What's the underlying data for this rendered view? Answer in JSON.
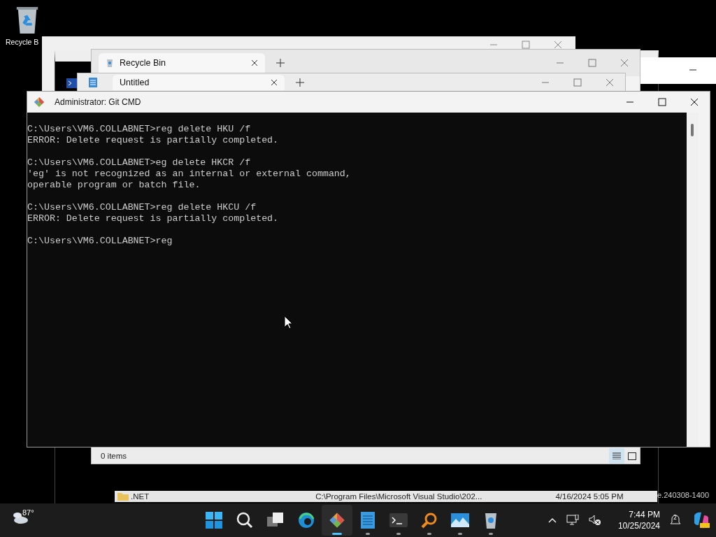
{
  "desktop_icons": [
    {
      "label": "Recycle B"
    }
  ],
  "windows": [
    {
      "kind": "blank"
    },
    {
      "kind": "console"
    },
    {
      "kind": "strip"
    },
    {
      "kind": "explorer",
      "tab": "Recycle Bin",
      "status": "0 items",
      "views": [
        {
          "selected": true
        },
        {
          "selected": false
        }
      ]
    },
    {
      "kind": "notepad",
      "tab": "Untitled"
    },
    {
      "kind": "filerow",
      "name": ".NET",
      "path": "C:\\Program Files\\Microsoft Visual Studio\\202...",
      "date": "4/16/2024 5:05 PM",
      "tail": "e.240308-1400"
    }
  ],
  "terminal": {
    "title": "Administrator: Git CMD",
    "blocks": [
      [
        "C:\\Users\\VM6.COLLABNET>reg delete HKU /f",
        "ERROR: Delete request is partially completed."
      ],
      [
        "C:\\Users\\VM6.COLLABNET>eg delete HKCR /f",
        "'eg' is not recognized as an internal or external command,",
        "operable program or batch file."
      ],
      [
        "C:\\Users\\VM6.COLLABNET>reg delete HKCU /f",
        "ERROR: Delete request is partially completed."
      ],
      [
        "C:\\Users\\VM6.COLLABNET>reg"
      ]
    ]
  },
  "taskbar": {
    "weather": "87°",
    "apps": [
      {
        "kind": "start",
        "running": false,
        "selected": false
      },
      {
        "kind": "search",
        "running": false,
        "selected": false
      },
      {
        "kind": "taskview",
        "running": false,
        "selected": false
      },
      {
        "kind": "edge",
        "running": false,
        "selected": false
      },
      {
        "kind": "git",
        "running": true,
        "selected": true
      },
      {
        "kind": "notepad",
        "running": true,
        "selected": false
      },
      {
        "kind": "terminal",
        "running": true,
        "selected": false
      },
      {
        "kind": "magnifier",
        "running": true,
        "selected": false
      },
      {
        "kind": "photos",
        "running": true,
        "selected": false
      },
      {
        "kind": "recycle",
        "running": true,
        "selected": false
      }
    ],
    "time": "7:44 PM",
    "date": "10/25/2024",
    "notifications": "2"
  }
}
